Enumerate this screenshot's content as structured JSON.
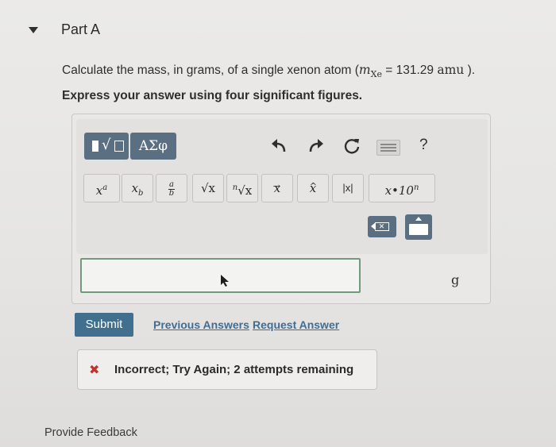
{
  "part": {
    "title": "Part A"
  },
  "question": {
    "prefix": "Calculate the mass, in grams, of a single xenon atom (",
    "m_symbol": "m",
    "m_subscript": "Xe",
    "equals": " = 131.29 ",
    "unit": "amu",
    "suffix": " )."
  },
  "instruction": "Express your answer using four significant figures.",
  "toolbar": {
    "greek_label": "ΑΣφ",
    "help_label": "?",
    "icons": [
      "templates-icon",
      "greek-icon",
      "undo-icon",
      "redo-icon",
      "reset-icon",
      "keyboard-icon",
      "help-icon"
    ]
  },
  "keys": {
    "power_base": "x",
    "power_exp": "a",
    "sub_base": "x",
    "sub_exp": "b",
    "frac_num": "a",
    "frac_den": "b",
    "sqrt": "√x",
    "nthroot_index": "n",
    "nthroot": "√x",
    "vector": "x",
    "hat": "x",
    "abs": "|x|",
    "sci": "x•10",
    "sci_exp": "n"
  },
  "answer": {
    "value": "",
    "unit": "g"
  },
  "actions": {
    "submit": "Submit",
    "previous_answers": "Previous Answers",
    "request_answer": "Request Answer"
  },
  "feedback": {
    "icon": "x-icon",
    "text": "Incorrect; Try Again; 2 attempts remaining",
    "color": "#c4322b"
  },
  "footer": {
    "provide_feedback": "Provide Feedback"
  }
}
